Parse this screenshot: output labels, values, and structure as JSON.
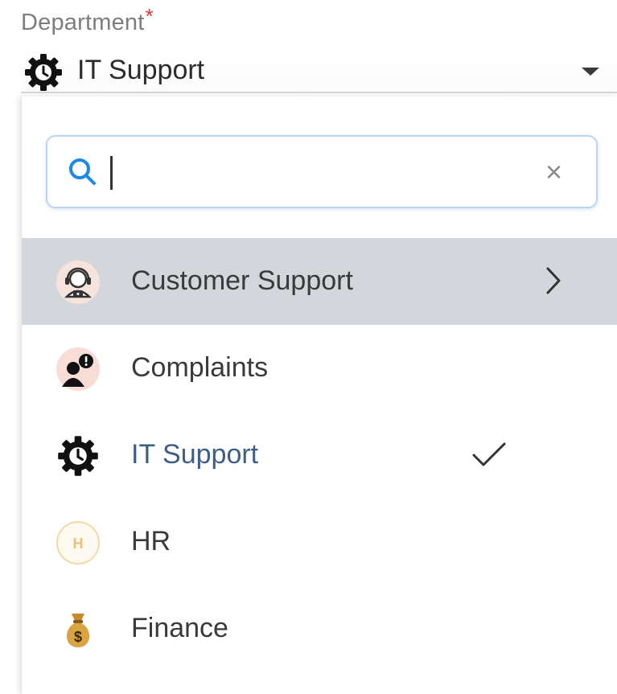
{
  "field": {
    "label": "Department",
    "required_mark": "*",
    "selected_value": "IT Support",
    "selected_icon": "gear-clock-icon"
  },
  "search": {
    "placeholder": "",
    "value": "",
    "search_icon": "search-icon",
    "clear_label": "×"
  },
  "options": [
    {
      "label": "Customer Support",
      "icon": "headset-agent-icon",
      "has_submenu": true,
      "highlighted": true
    },
    {
      "label": "Complaints",
      "icon": "user-alert-icon"
    },
    {
      "label": "IT Support",
      "icon": "gear-clock-icon",
      "selected": true
    },
    {
      "label": "HR",
      "icon": "letter-h-badge-icon"
    },
    {
      "label": "Finance",
      "icon": "money-bag-icon"
    }
  ],
  "colors": {
    "required": "#e53935",
    "highlight_row": "#d3d6db",
    "selected_text": "#3f5e86",
    "search_border": "#bcd6f1",
    "search_icon": "#1e88e5"
  }
}
